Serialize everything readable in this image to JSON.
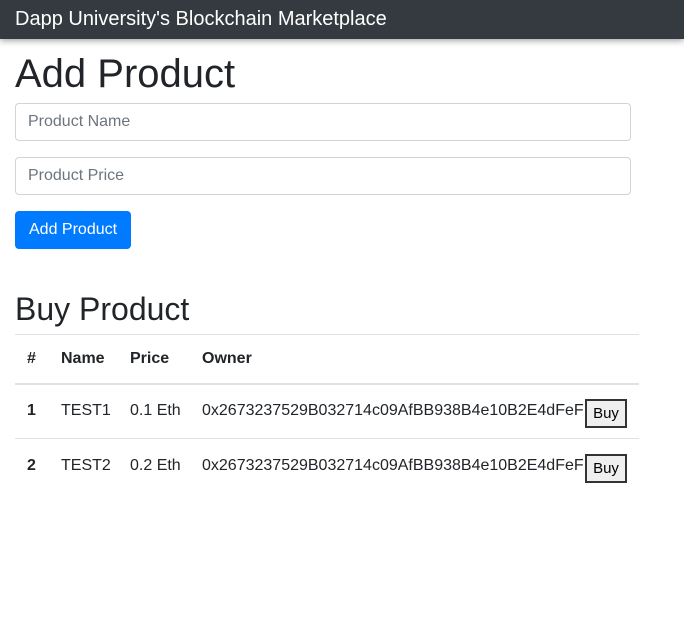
{
  "navbar": {
    "brand": "Dapp University's Blockchain Marketplace"
  },
  "add_product": {
    "title": "Add Product",
    "name_placeholder": "Product Name",
    "price_placeholder": "Product Price",
    "submit_label": "Add Product"
  },
  "buy_product": {
    "title": "Buy Product",
    "columns": [
      "#",
      "Name",
      "Price",
      "Owner"
    ],
    "rows": [
      {
        "id": "1",
        "name": "TEST1",
        "price": "0.1 Eth",
        "owner": "0x2673237529B032714c09AfBB938B4e10B2E4dFeF",
        "action": "Buy"
      },
      {
        "id": "2",
        "name": "TEST2",
        "price": "0.2 Eth",
        "owner": "0x2673237529B032714c09AfBB938B4e10B2E4dFeF",
        "action": "Buy"
      }
    ]
  },
  "colors": {
    "navbar_bg": "#343a40",
    "primary": "#007bff",
    "text": "#212529",
    "border": "#dee2e6"
  }
}
